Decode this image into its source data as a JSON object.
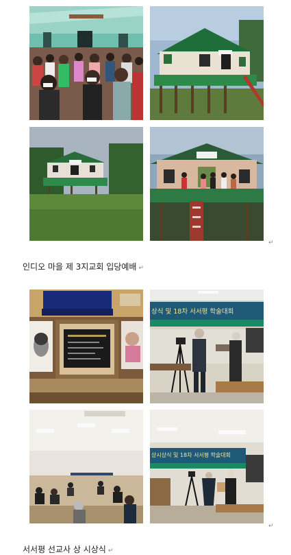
{
  "captions": {
    "first": "인디오 마을 제 3지교회 입당예배",
    "second": "서서평 선교사 상 시상식"
  },
  "para_mark": "↵",
  "banner": {
    "text_a": "상식 및 18차 서서평 학술대회",
    "text_b": "상시상식 및 18차 서서평 학술대회"
  },
  "plaque_text": "제2회 서서평 상 Shepping Award"
}
